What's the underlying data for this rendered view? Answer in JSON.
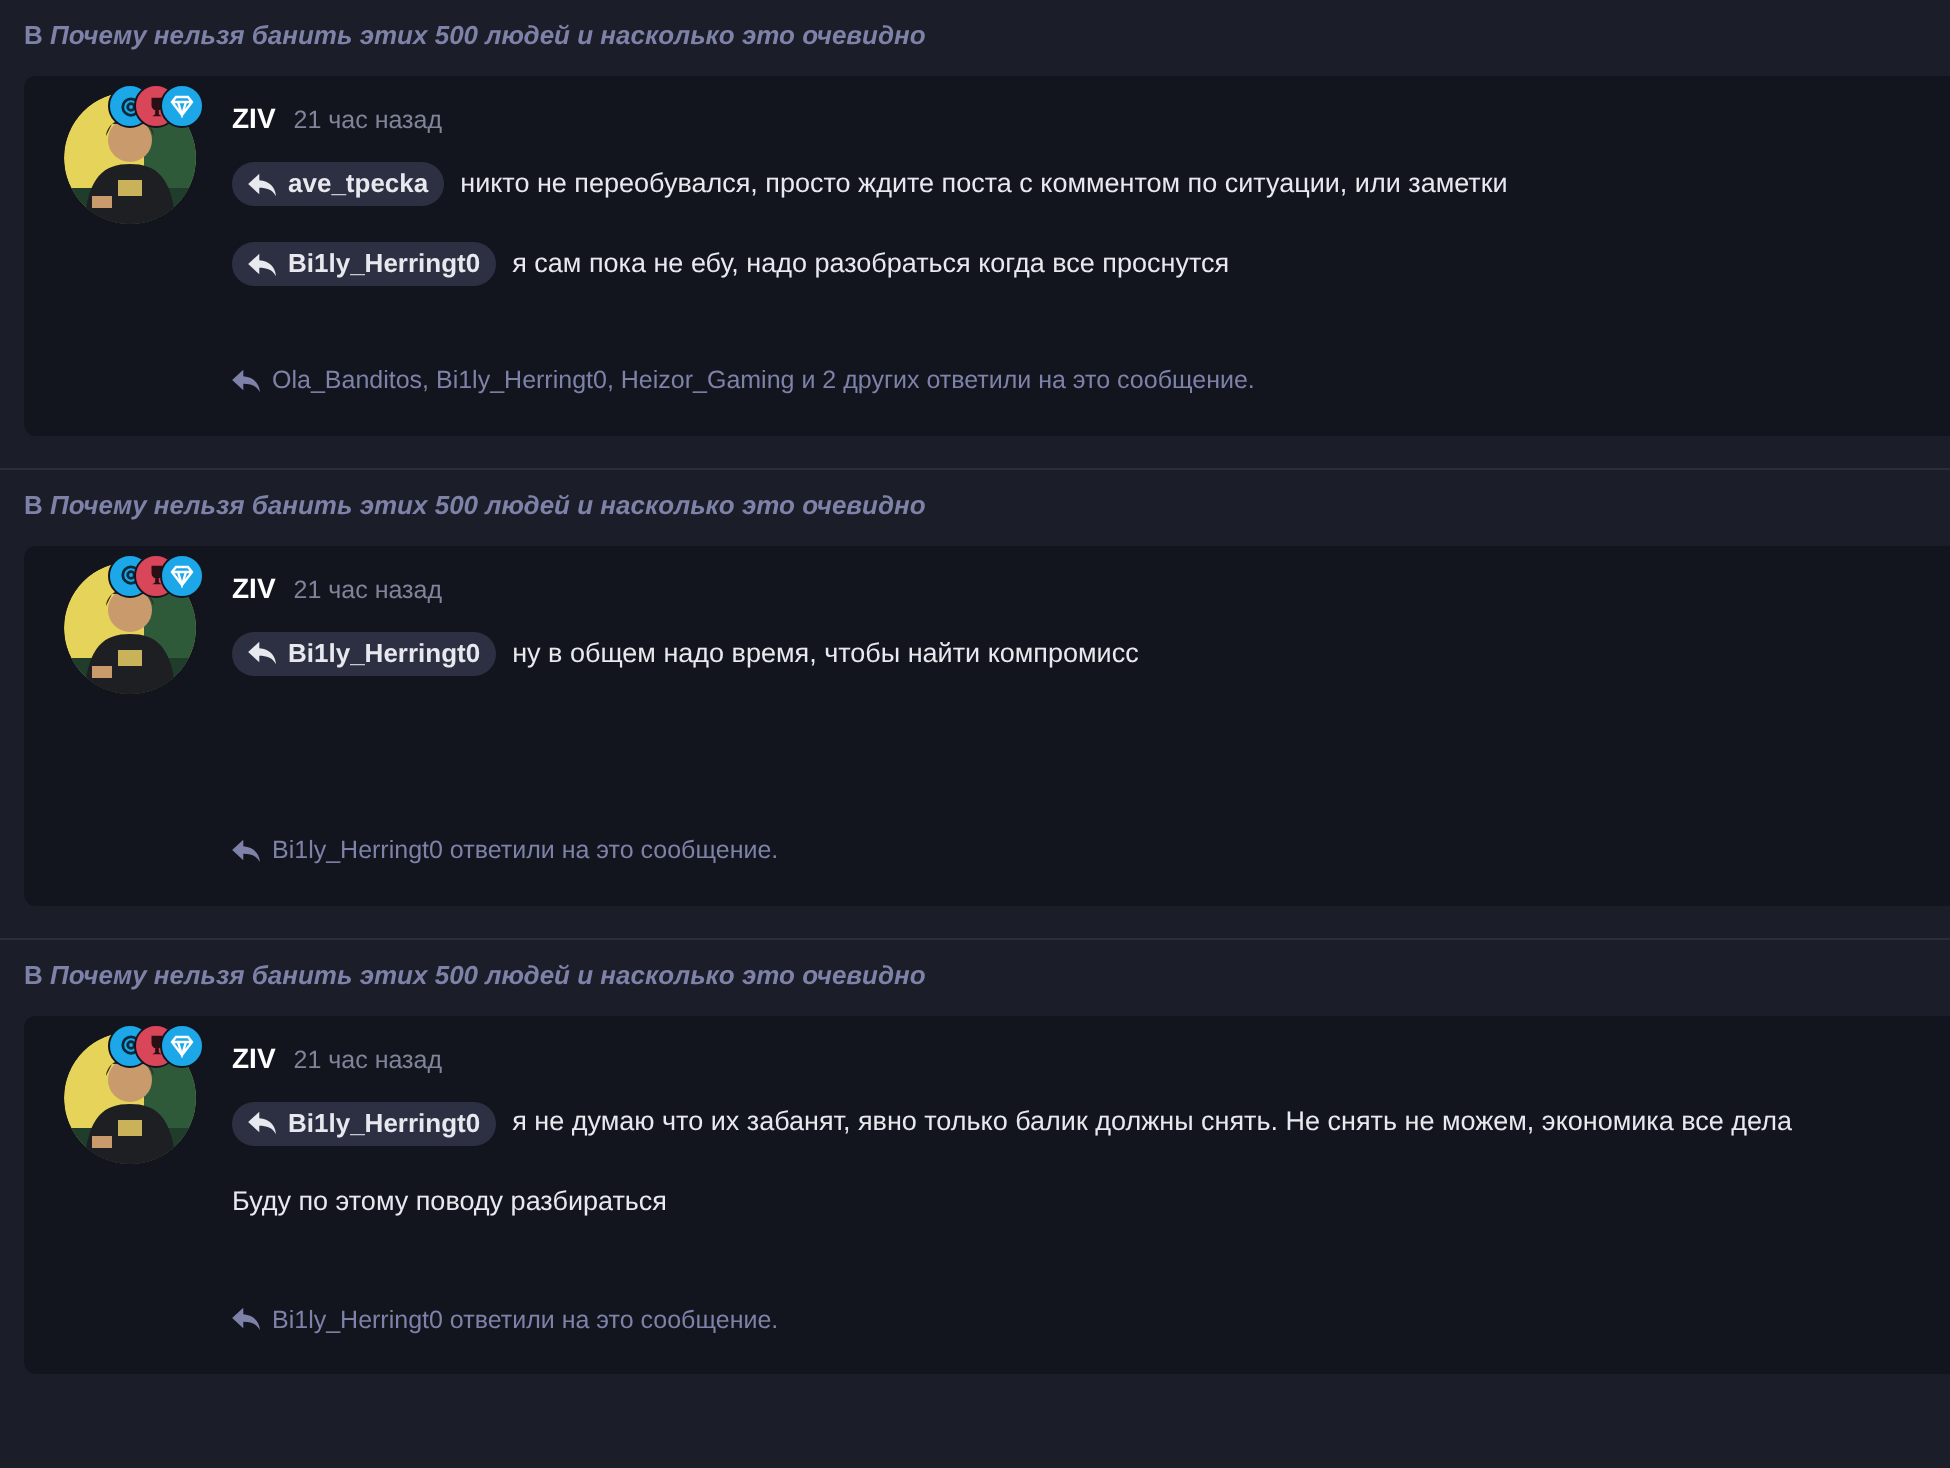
{
  "posts": [
    {
      "thread": "В *Почему нельзя банить этих 500 людей и насколько это очевидно*",
      "author": "ZIV",
      "time": "21 час назад",
      "badges": [
        {
          "color": "#1ca7e8"
        },
        {
          "color": "#d9465a"
        },
        {
          "color": "#1ca7e8"
        }
      ],
      "lines": [
        {
          "kind": "mention",
          "user": "ave_tpecka",
          "text": "никто не переобувался, просто ждите поста с комментом по ситуации, или заметки"
        },
        {
          "kind": "mention",
          "user": "Bi1ly_Herringt0",
          "text": "я сам пока не ебу, надо разобраться когда все проснутся"
        }
      ],
      "replies": "Ola_Banditos, Bi1ly_Herringt0, Heizor_Gaming и 2 других ответили на это сообщение."
    },
    {
      "thread": "В *Почему нельзя банить этих 500 людей и насколько это очевидно*",
      "author": "ZIV",
      "time": "21 час назад",
      "badges": [
        {
          "color": "#1ca7e8"
        },
        {
          "color": "#d9465a"
        },
        {
          "color": "#1ca7e8"
        }
      ],
      "lines": [
        {
          "kind": "mention",
          "user": "Bi1ly_Herringt0",
          "text": "ну в общем надо время, чтобы найти компромисс"
        }
      ],
      "replies": "Bi1ly_Herringt0 ответили на это сообщение."
    },
    {
      "thread": "В *Почему нельзя банить этих 500 людей и насколько это очевидно*",
      "author": "ZIV",
      "time": "21 час назад",
      "badges": [
        {
          "color": "#1ca7e8"
        },
        {
          "color": "#d9465a"
        },
        {
          "color": "#1ca7e8"
        }
      ],
      "lines": [
        {
          "kind": "mention",
          "user": "Bi1ly_Herringt0",
          "text": "я не думаю что их забанят, явно только балик должны снять. Не снять не можем, экономика все дела"
        },
        {
          "kind": "plain",
          "text": "Буду по этому поводу разбираться"
        }
      ],
      "replies": "Bi1ly_Herringt0 ответили на это сообщение."
    }
  ]
}
